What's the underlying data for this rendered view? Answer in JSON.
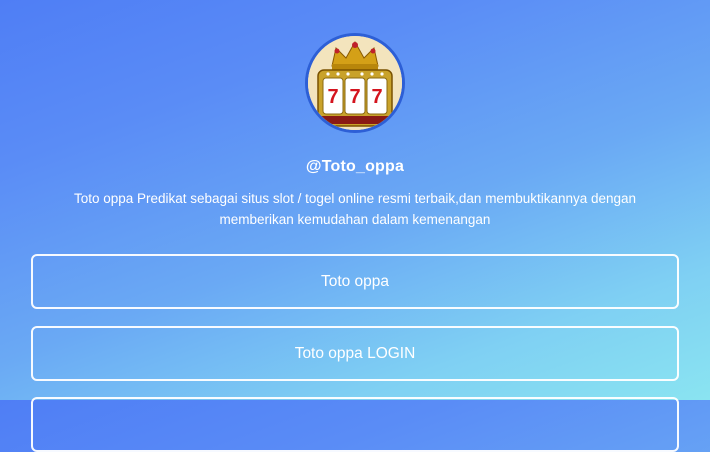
{
  "profile": {
    "handle": "@Toto_oppa",
    "bio": "Toto oppa Predikat sebagai situs slot / togel online resmi terbaik,dan membuktikannya dengan memberikan kemudahan dalam kemenangan",
    "avatar_icon": "slot-machine-777-image"
  },
  "links": [
    {
      "label": "Toto oppa"
    },
    {
      "label": "Toto oppa LOGIN"
    },
    {
      "label": ""
    }
  ],
  "colors": {
    "gradient_top": "#4f7ef5",
    "gradient_bottom": "#8ae4f1",
    "avatar_border": "#2d5fd6",
    "button_border": "#ffffff",
    "text": "#ffffff"
  }
}
